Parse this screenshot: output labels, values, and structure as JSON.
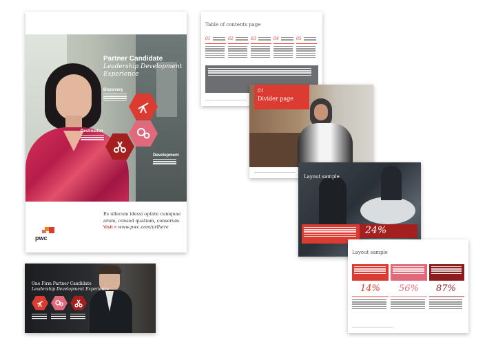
{
  "cover": {
    "title": "Partner Candidate",
    "subtitle_line1": "Leadership Development",
    "subtitle_line2": "Experience",
    "hex_labels": [
      "Discovery",
      "Destination",
      "Development"
    ],
    "body_line1": "Es ullecum idessi optate cumquae",
    "body_line2": "arum, consed quatiam, conserum.",
    "visit_label": "Visit >",
    "visit_url": "www.pwc.com/urlhere",
    "logo_text": "pwc"
  },
  "toc": {
    "title": "Table of contents page",
    "items": [
      {
        "num": "01"
      },
      {
        "num": "02"
      },
      {
        "num": "03"
      },
      {
        "num": "04"
      },
      {
        "num": "05"
      }
    ]
  },
  "divider": {
    "num": "01",
    "title": "Divider page"
  },
  "layout1": {
    "title": "Layout sample",
    "stat": "24%"
  },
  "layout2": {
    "title": "Layout sample",
    "stats": [
      "14%",
      "56%",
      "87%"
    ]
  },
  "banner": {
    "title_line1": "One Firm Partner Candidate",
    "title_line2": "Leadership Development Experience"
  },
  "colors": {
    "accent": "#dc3b32",
    "dark_red": "#a3201e",
    "pink": "#e06a7c",
    "maroon": "#8c1d1c",
    "orange": "#eb8c00"
  },
  "icons": [
    "telescope-icon",
    "gears-icon",
    "scissors-icon"
  ]
}
